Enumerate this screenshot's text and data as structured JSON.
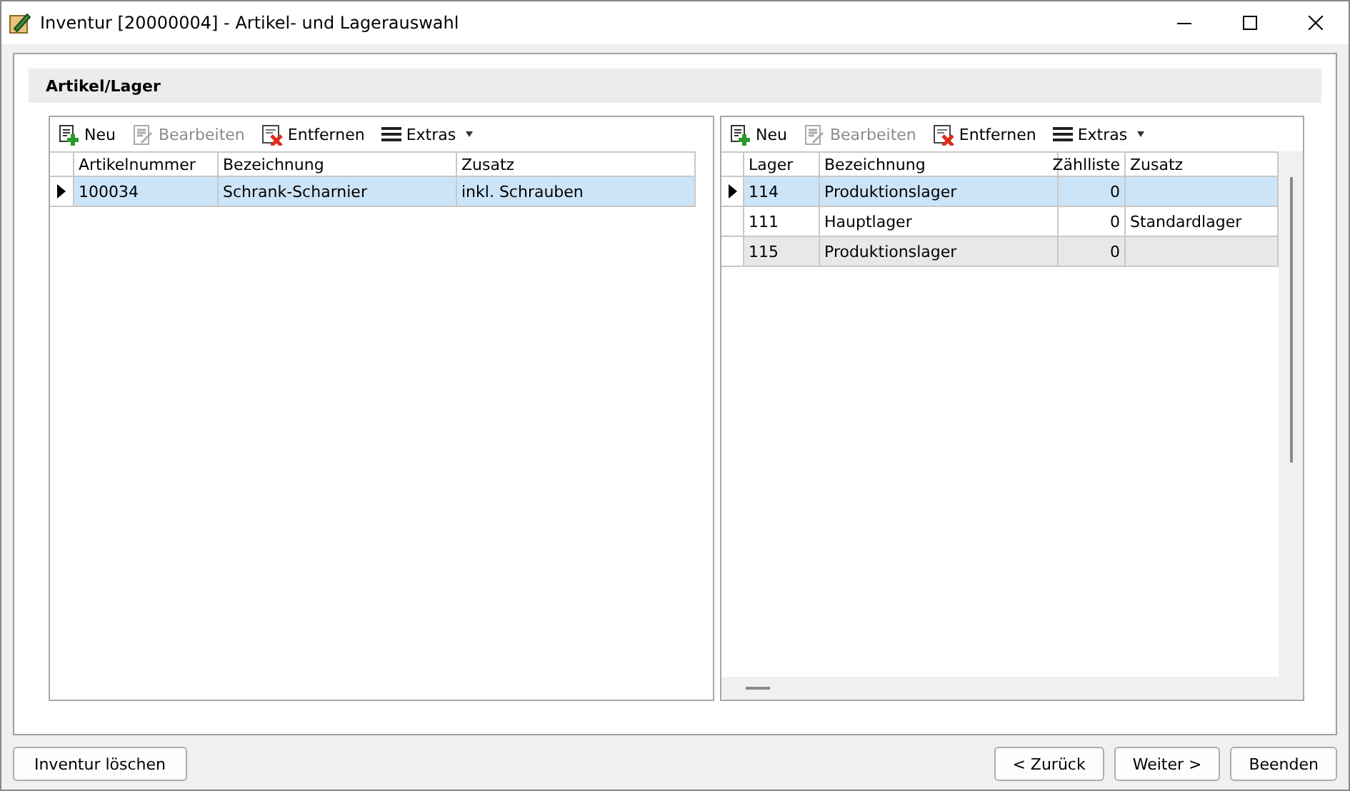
{
  "window": {
    "title": "Inventur [20000004] - Artikel- und Lagerauswahl"
  },
  "section": {
    "title": "Artikel/Lager"
  },
  "panels": [
    {
      "toolbar": [
        {
          "kind": "new",
          "label": "Neu",
          "disabled": false
        },
        {
          "kind": "edit",
          "label": "Bearbeiten",
          "disabled": true
        },
        {
          "kind": "remove",
          "label": "Entfernen",
          "disabled": false
        },
        {
          "kind": "menu",
          "label": "Extras",
          "disabled": false
        }
      ],
      "columns": [
        {
          "label": "Artikelnummer",
          "kind": "text"
        },
        {
          "label": "Bezeichnung",
          "kind": "text"
        },
        {
          "label": "Zusatz",
          "kind": "text"
        }
      ],
      "rows": [
        {
          "selected": true,
          "cells": [
            "100034",
            "Schrank-Scharnier",
            "inkl. Schrauben"
          ]
        }
      ]
    },
    {
      "toolbar": [
        {
          "kind": "new",
          "label": "Neu",
          "disabled": false
        },
        {
          "kind": "edit",
          "label": "Bearbeiten",
          "disabled": true
        },
        {
          "kind": "remove",
          "label": "Entfernen",
          "disabled": false
        },
        {
          "kind": "menu",
          "label": "Extras",
          "disabled": false
        }
      ],
      "columns": [
        {
          "label": "Lager",
          "kind": "text"
        },
        {
          "label": "Bezeichnung",
          "kind": "text"
        },
        {
          "label": "Zählliste",
          "kind": "number"
        },
        {
          "label": "Zusatz",
          "kind": "text"
        }
      ],
      "rows": [
        {
          "selected": true,
          "cells": [
            "114",
            "Produktionslager",
            "0",
            ""
          ]
        },
        {
          "selected": false,
          "cells": [
            "111",
            "Hauptlager",
            "0",
            "Standardlager"
          ]
        },
        {
          "selected": false,
          "cells": [
            "115",
            "Produktionslager",
            "0",
            ""
          ]
        }
      ]
    }
  ],
  "footer": {
    "left": [
      "Inventur löschen"
    ],
    "right": [
      "<  Zurück",
      "Weiter >",
      "Beenden"
    ]
  }
}
